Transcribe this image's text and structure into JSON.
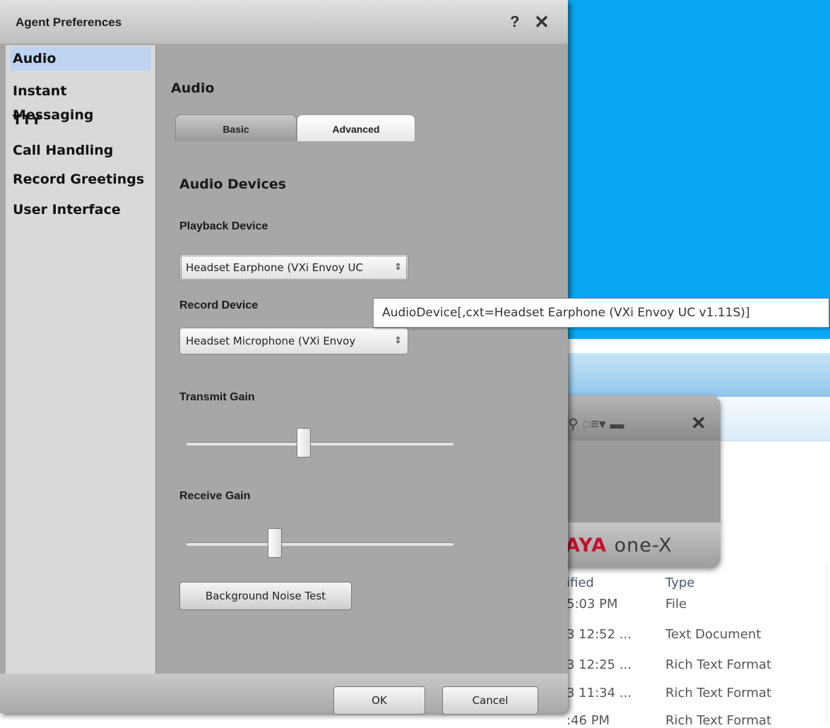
{
  "dialog": {
    "title": "Agent Preferences",
    "help_label": "?",
    "close_label": "✕"
  },
  "sidebar": {
    "items": [
      {
        "label": "Audio",
        "selected": true
      },
      {
        "label": "Instant Messaging",
        "selected": false
      },
      {
        "label": "TTY",
        "selected": false
      },
      {
        "label": "Call Handling",
        "selected": false
      },
      {
        "label": "Record Greetings",
        "selected": false
      },
      {
        "label": "User Interface",
        "selected": false
      }
    ]
  },
  "main": {
    "section_title": "Audio",
    "tabs": [
      {
        "label": "Basic",
        "active": false
      },
      {
        "label": "Advanced",
        "active": true
      }
    ],
    "group_title": "Audio Devices",
    "playback": {
      "label": "Playback Device",
      "value": "Headset Earphone (VXi Envoy UC",
      "arrow": "⇕"
    },
    "record": {
      "label": "Record Device",
      "value": "Headset Microphone (VXi Envoy",
      "arrow": "⇕"
    },
    "transmit_gain": {
      "label": "Transmit Gain",
      "level": 0.44
    },
    "receive_gain": {
      "label": "Receive Gain",
      "level": 0.33
    },
    "noise_button": "Background Noise Test"
  },
  "footer": {
    "ok_label": "OK",
    "cancel_label": "Cancel"
  },
  "tooltip": {
    "text": "AudioDevice[,cxt=Headset Earphone (VXi Envoy UC v1.11S)]"
  },
  "onex_widget": {
    "logo_avaya": "AYA",
    "logo_onex": "one-X",
    "icons": "⚲ ◌≡▾ ▬",
    "close_label": "✕"
  },
  "background_window": {
    "headers": [
      "ified",
      "Type"
    ],
    "rows": [
      {
        "modified": "5:03 PM",
        "type": "File"
      },
      {
        "modified": "3 12:52 ...",
        "type": "Text Document"
      },
      {
        "modified": "3 12:25 ...",
        "type": "Rich Text Format"
      },
      {
        "modified": "3 11:34 ...",
        "type": "Rich Text Format"
      },
      {
        "modified": ":46 PM",
        "type": "Rich Text Format"
      }
    ]
  },
  "colors": {
    "desktop_blue": "#08a8f2",
    "dialog_gray": "#a7a7a7",
    "selection": "#bcd4ef",
    "avaya_red": "#c8102e"
  }
}
